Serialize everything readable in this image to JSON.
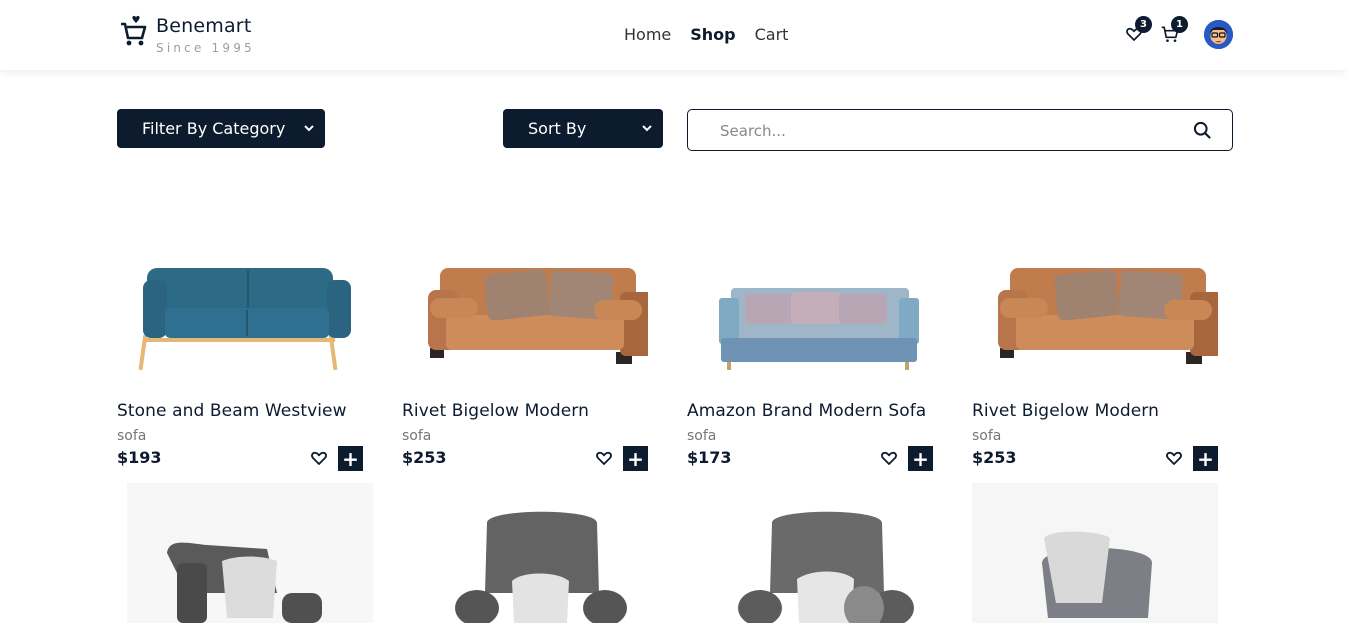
{
  "brand": {
    "name": "Benemart",
    "tagline": "Since 1995",
    "logo_icon": "cart-heart-icon"
  },
  "nav": {
    "home": "Home",
    "shop": "Shop",
    "cart": "Cart",
    "active": "Shop"
  },
  "header_icons": {
    "wishlist_count": "3",
    "cart_count": "1"
  },
  "filters": {
    "category_label": "Filter By Category",
    "sort_label": "Sort By",
    "search_placeholder": "Search..."
  },
  "products": [
    {
      "title": "Stone and Beam Westview",
      "category": "sofa",
      "price": "$193"
    },
    {
      "title": "Rivet Bigelow Modern",
      "category": "sofa",
      "price": "$253"
    },
    {
      "title": "Amazon Brand Modern Sofa",
      "category": "sofa",
      "price": "$173"
    },
    {
      "title": "Rivet Bigelow Modern",
      "category": "sofa",
      "price": "$253"
    }
  ],
  "colors": {
    "primary": "#0d1b2e",
    "muted": "#777777"
  }
}
